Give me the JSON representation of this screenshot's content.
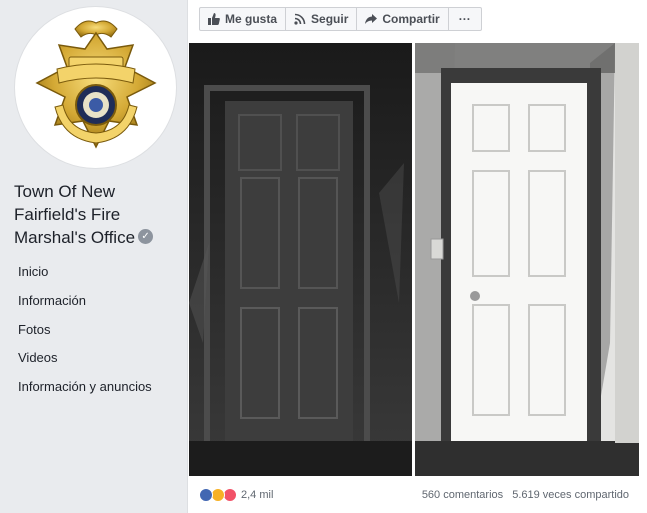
{
  "badge": {
    "line1": "FIRE",
    "line2": "MARSHAL",
    "line3": "NEW FAIRFIELD"
  },
  "page": {
    "name": "Town Of New Fairfield's Fire Marshal's Office"
  },
  "nav": {
    "items": [
      {
        "label": "Inicio"
      },
      {
        "label": "Información"
      },
      {
        "label": "Fotos"
      },
      {
        "label": "Videos"
      },
      {
        "label": "Información y anuncios"
      }
    ]
  },
  "actions": {
    "like": "Me gusta",
    "follow": "Seguir",
    "share": "Compartir",
    "more": "···"
  },
  "post": {
    "reactions_count": "2,4 mil",
    "comments": "560 comentarios",
    "shares": "5.619 veces compartido"
  },
  "colors": {
    "like_blue": "#4267b2",
    "wow_yellow": "#f7b125",
    "love_red": "#f25268",
    "badge_gold": "#d4a935"
  },
  "icons": [
    "like-icon",
    "rss-icon",
    "share-icon",
    "more-icon",
    "verified-icon"
  ]
}
